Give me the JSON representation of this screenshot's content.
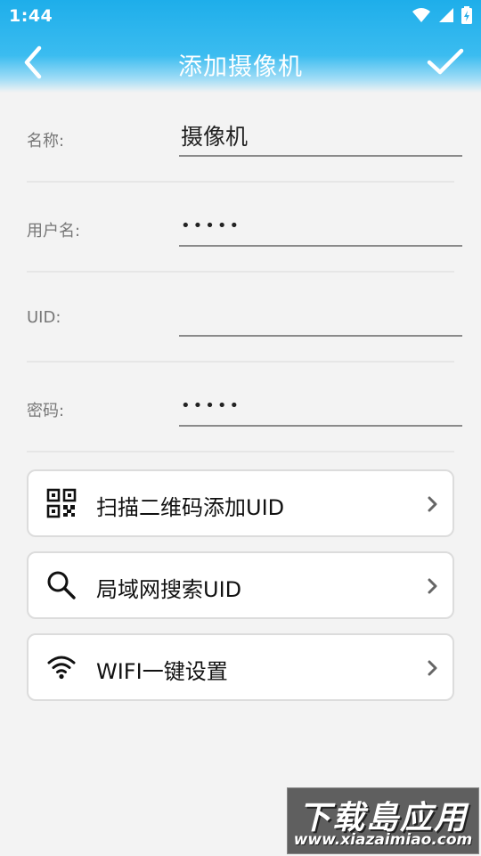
{
  "status_bar": {
    "time": "1:44"
  },
  "header": {
    "title": "添加摄像机"
  },
  "form": {
    "fields": [
      {
        "label": "名称:",
        "value": "摄像机",
        "type": "text"
      },
      {
        "label": "用户名:",
        "value": "•••••",
        "type": "password"
      },
      {
        "label": "UID:",
        "value": "",
        "type": "text"
      },
      {
        "label": "密码:",
        "value": "•••••",
        "type": "password"
      }
    ]
  },
  "actions": [
    {
      "label": "扫描二维码添加UID",
      "icon": "qr-code-icon"
    },
    {
      "label": "局域网搜索UID",
      "icon": "search-icon"
    },
    {
      "label": "WIFI一键设置",
      "icon": "wifi-icon"
    }
  ],
  "watermark": {
    "title": "下载島应用",
    "site": "www.xiazaimiao.com"
  },
  "colors": {
    "header": "#1eaeea",
    "background": "#f3f3f3",
    "text": "#111111"
  }
}
